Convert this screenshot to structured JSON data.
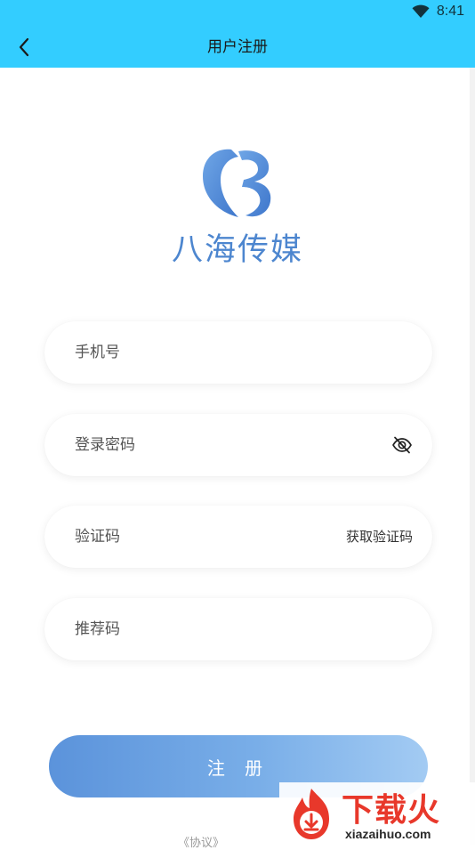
{
  "status_bar": {
    "time": "8:41",
    "wifi_icon": "wifi-icon"
  },
  "header": {
    "back_icon": "chevron-left-icon",
    "title": "用户注册"
  },
  "brand": {
    "logo_icon": "bahai-logo-icon",
    "name": "八海传媒"
  },
  "form": {
    "phone": {
      "placeholder": "手机号",
      "value": ""
    },
    "password": {
      "placeholder": "登录密码",
      "value": "",
      "toggle_icon": "eye-off-icon"
    },
    "code": {
      "placeholder": "验证码",
      "value": "",
      "button_label": "获取验证码"
    },
    "referral": {
      "placeholder": "推荐码",
      "value": ""
    }
  },
  "submit_label": "注 册",
  "agreement_text": "《协议》",
  "watermark": {
    "brand": "下载火",
    "url": "xiazaihuo.com"
  },
  "colors": {
    "header_bg": "#33cdff",
    "button_start": "#5b93db",
    "button_end": "#a3cbf3",
    "brand_blue": "#4d86cf",
    "watermark_red": "#e8382b"
  }
}
